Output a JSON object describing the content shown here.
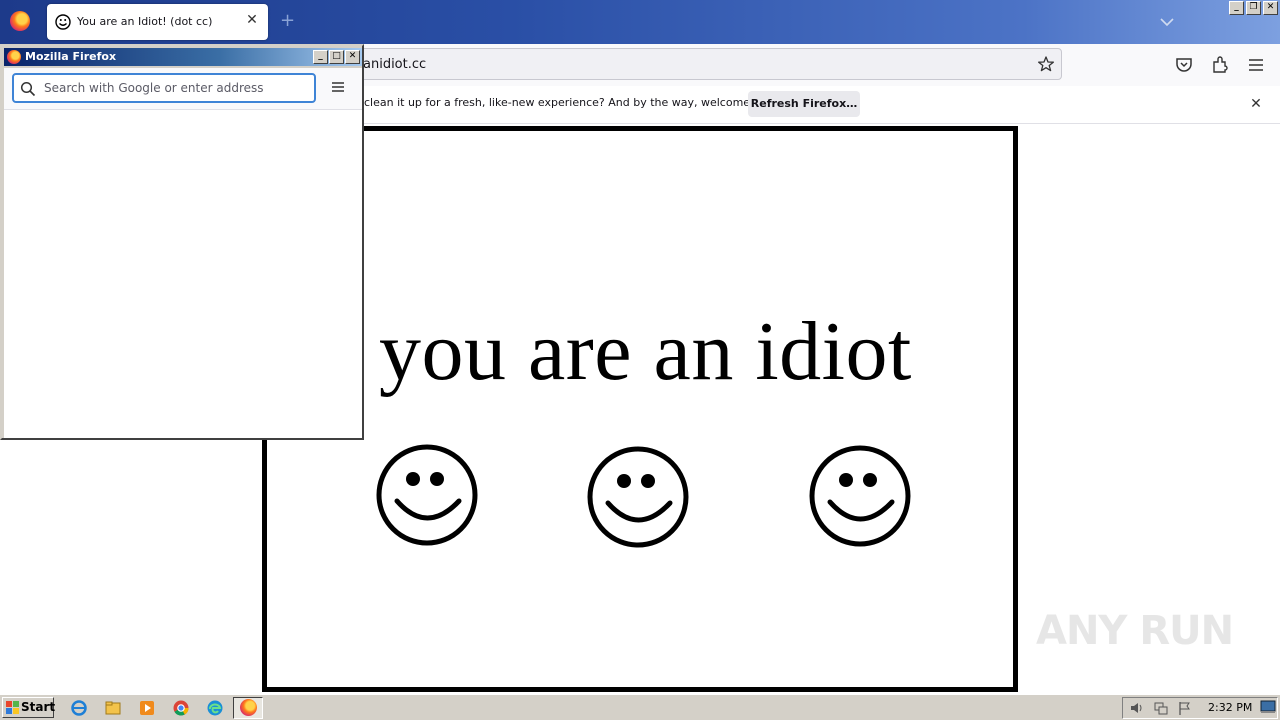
{
  "browser": {
    "tab": {
      "title": "You are an Idiot! (dot cc)"
    },
    "url": "anidiot.cc",
    "notification": {
      "message": "clean it up for a fresh, like-new experience? And by the way, welcome back!",
      "button": "Refresh Firefox…"
    }
  },
  "page": {
    "headline": "you are an idiot",
    "smileys": [
      "smiley-face",
      "smiley-face",
      "smiley-face"
    ]
  },
  "popup": {
    "title": "Mozilla Firefox",
    "search_placeholder": "Search with Google or enter address"
  },
  "taskbar": {
    "start": "Start",
    "clock": "2:32 PM"
  },
  "watermark": "ANY RUN"
}
